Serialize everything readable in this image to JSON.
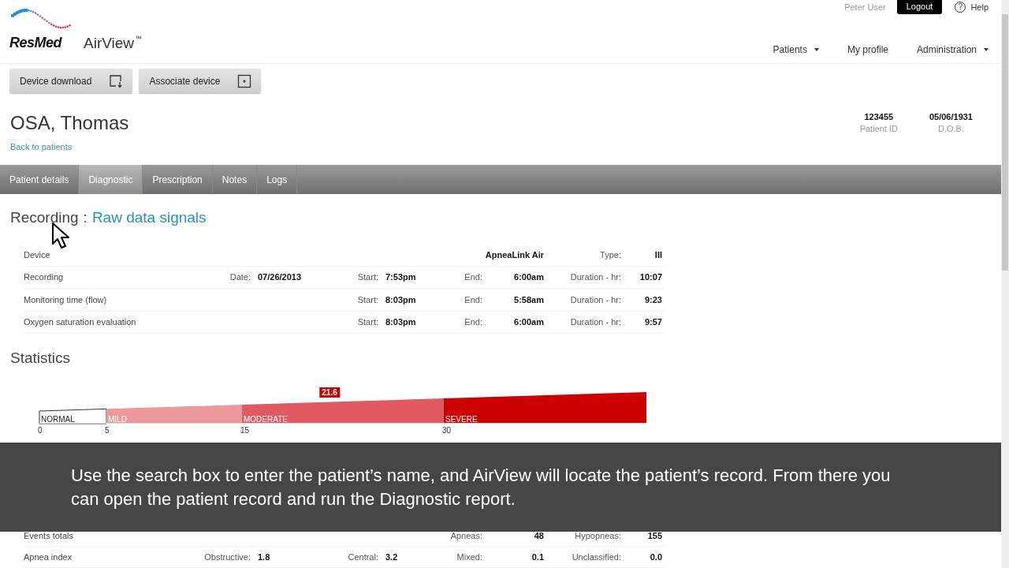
{
  "header": {
    "brand": "ResMed",
    "product": "AirView",
    "trademark": "™",
    "user": "Peter User",
    "logout": "Logout",
    "help_icon": "?",
    "help": "Help",
    "nav": [
      {
        "label": "Patients",
        "dropdown": true
      },
      {
        "label": "My profile",
        "dropdown": false
      },
      {
        "label": "Administration",
        "dropdown": true
      }
    ]
  },
  "actions": [
    {
      "label": "Device download",
      "kind": "download"
    },
    {
      "label": "Associate device",
      "kind": "add"
    }
  ],
  "patient": {
    "name": "OSA, Thomas",
    "back_link": "Back to patients",
    "facts": [
      {
        "value": "123455",
        "label": "Patient ID"
      },
      {
        "value": "05/06/1931",
        "label": "D.O.B."
      }
    ]
  },
  "tabs": [
    {
      "label": "Patient details",
      "selected": false
    },
    {
      "label": "Diagnostic",
      "selected": true
    },
    {
      "label": "Prescription",
      "selected": false
    },
    {
      "label": "Notes",
      "selected": false
    },
    {
      "label": "Logs",
      "selected": false
    }
  ],
  "recording": {
    "title": "Recording",
    "separator": ":",
    "link": "Raw data signals",
    "rows": [
      {
        "label": "Device",
        "cells": [
          "",
          "",
          {
            "value": "ApneaLink Air"
          },
          {
            "label": "Type:",
            "value": "III"
          }
        ]
      },
      {
        "label": "Recording",
        "cells": [
          {
            "label": "Date:",
            "value": "07/26/2013"
          },
          {
            "label": "Start:",
            "value": "7:53pm"
          },
          {
            "label": "End:",
            "value": "6:00am"
          },
          {
            "label": "Duration - hr:",
            "value": "10:07"
          }
        ]
      },
      {
        "label": "Monitoring time (flow)",
        "cells": [
          "",
          {
            "label": "Start:",
            "value": "8:03pm"
          },
          {
            "label": "End:",
            "value": "5:58am"
          },
          {
            "label": "Duration - hr:",
            "value": "9:23"
          }
        ]
      },
      {
        "label": "Oxygen saturation evaluation",
        "cells": [
          "",
          {
            "label": "Start:",
            "value": "8:03pm"
          },
          {
            "label": "End:",
            "value": "6:00am"
          },
          {
            "label": "Duration - hr:",
            "value": "9:57"
          }
        ]
      }
    ]
  },
  "statistics": {
    "title": "Statistics",
    "severity": {
      "marker": "21.6",
      "level": 0.478,
      "bands": [
        {
          "label": "NORMAL",
          "color": "#ffffff",
          "tick": "0"
        },
        {
          "label": "MILD",
          "color": "#eb9a9c",
          "tick": "5"
        },
        {
          "label": "MODERATE",
          "color": "#e05a62",
          "tick": "15"
        },
        {
          "label": "SEVERE",
          "color": "#cc0000",
          "tick": "30"
        }
      ]
    },
    "rows": [
      {
        "label": "Events totals",
        "cells": [
          "",
          "",
          {
            "label": "Apneas:",
            "value": "48"
          },
          {
            "label": "Hypopneas:",
            "value": "155"
          }
        ]
      },
      {
        "label": "Apnea index",
        "cells": [
          {
            "label": "Obstructive:",
            "value": "1.8"
          },
          {
            "label": "Central:",
            "value": "3.2"
          },
          {
            "label": "Mixed:",
            "value": "0.1"
          },
          {
            "label": "Unclassified:",
            "value": "0.0"
          }
        ]
      }
    ]
  },
  "caption": "Use the search box to enter the patient’s name, and AirView will locate the patient’s record.  From there you can open the patient record and run the Diagnostic report."
}
